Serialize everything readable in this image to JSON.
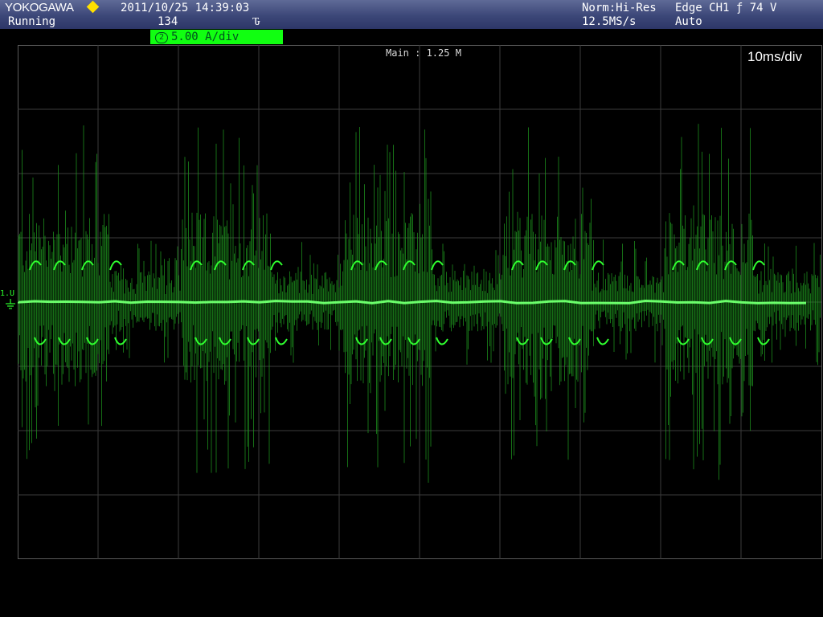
{
  "header": {
    "brand": "YOKOGAWA",
    "datetime": "2011/10/25  14:39:03",
    "status": "Running",
    "acq_count": "134",
    "trigger_icon": "Ԏ",
    "acq_mode": "Norm:Hi-Res",
    "sample_rate": "12.5MS/s",
    "trigger": "Edge CH1 ƒ 74 V",
    "trigger_mode": "Auto"
  },
  "channel": {
    "number": "2",
    "scale": "5.00 A/div",
    "color": "#11ff11",
    "marker": "1.U"
  },
  "display": {
    "memory": "Main : 1.25 M",
    "timebase": "10ms/div",
    "grid_color": "#3b3b3b",
    "trace_color": "#2fff2f"
  },
  "icons": [
    "yokogawa-diamond-icon",
    "trigger-edge-icon",
    "ground-icon"
  ]
}
